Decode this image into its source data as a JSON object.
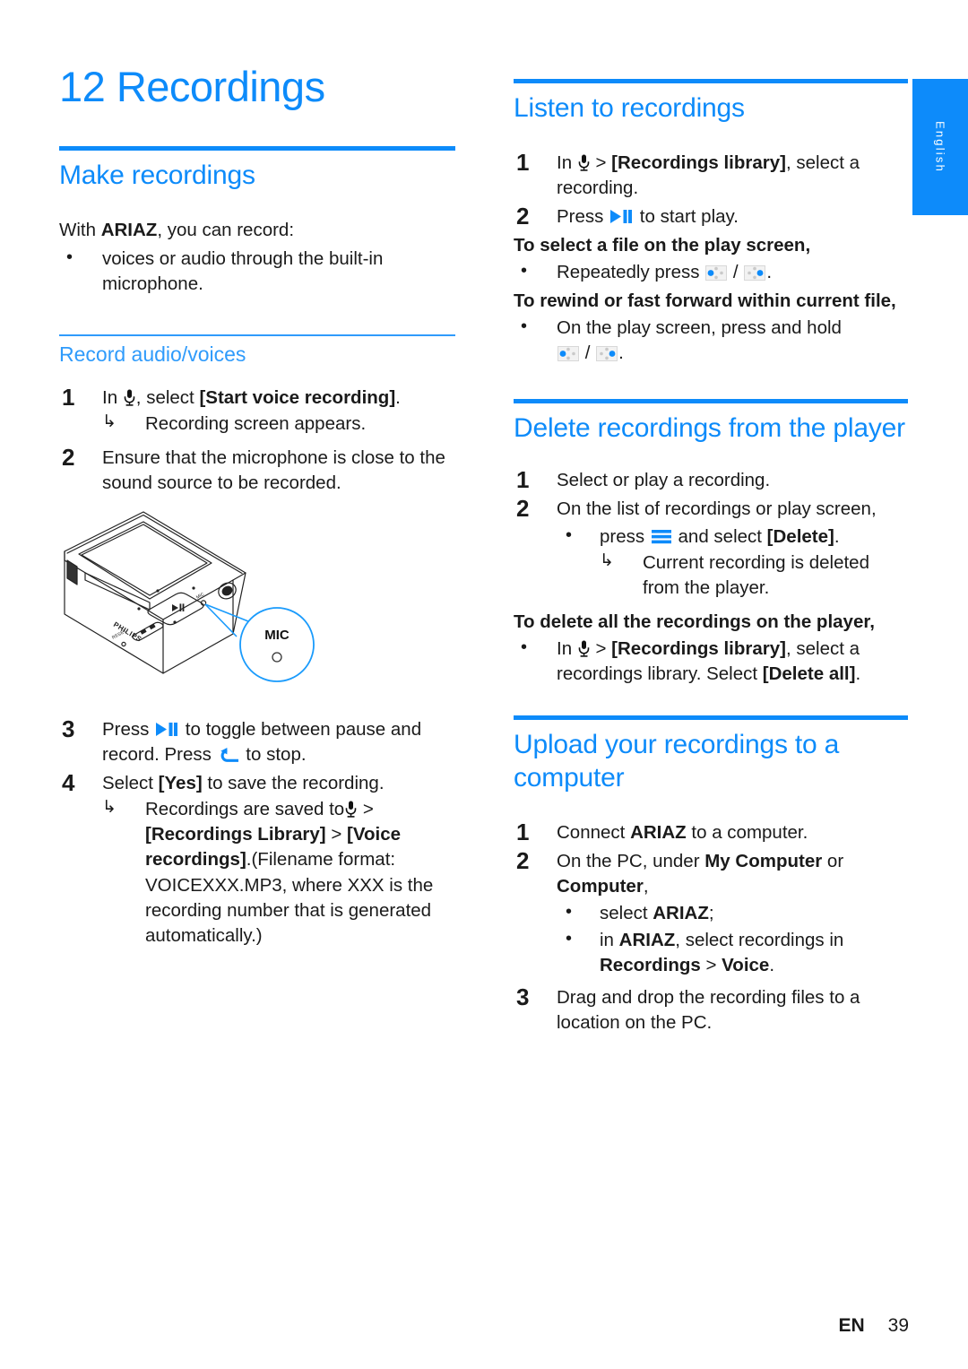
{
  "language_tab": {
    "label": "English"
  },
  "chapter": {
    "number": "12",
    "title": "Recordings",
    "heading": "12 Recordings"
  },
  "left_column": {
    "section_make": {
      "heading": "Make recordings",
      "intro_prefix": "With ",
      "intro_brand": "ARIAZ",
      "intro_suffix": ", you can record:",
      "bullet_1": "voices or audio through the built-in microphone."
    },
    "subsection_record": {
      "heading": "Record audio/voices",
      "step_1": {
        "num": "1",
        "text_before_icon": "In ",
        "icon": "mic-icon",
        "text_after_icon": ", select ",
        "bold_value": "[Start voice recording]",
        "text_end": ".",
        "result": "Recording screen appears."
      },
      "step_2": {
        "num": "2",
        "text": "Ensure that the microphone is close to the sound source to be recorded."
      },
      "illustration": {
        "brand_text": "PHILIPS",
        "reset_text": "RESET",
        "callout_label": "MIC"
      },
      "step_3": {
        "num": "3",
        "text_a": "Press ",
        "icon_a": "play-pause-icon",
        "text_b": " to toggle between pause and record. Press ",
        "icon_b": "back-icon",
        "text_c": " to stop."
      },
      "step_4": {
        "num": "4",
        "text_a": "Select ",
        "bold_a": "[Yes]",
        "text_b": " to save the recording.",
        "result_a": "Recordings are saved to",
        "result_icon": "mic-icon",
        "result_b": " > ",
        "result_bold_1": "[Recordings Library]",
        "result_c": " > ",
        "result_bold_2": "[Voice recordings]",
        "result_d": ".(Filename format: VOICEXXX.MP3, where XXX is the recording number that is generated automatically.)"
      }
    }
  },
  "right_column": {
    "section_listen": {
      "heading": "Listen to recordings",
      "step_1": {
        "num": "1",
        "text_a": "In ",
        "icon": "mic-icon",
        "text_b": " > ",
        "bold": "[Recordings library]",
        "text_c": ", select a recording."
      },
      "step_2": {
        "num": "2",
        "text_a": "Press ",
        "icon": "play-pause-icon",
        "text_b": " to start play."
      },
      "leadin_1": "To select a file on the play screen,",
      "bullet_1": {
        "text_a": "Repeatedly press ",
        "icon_prev": "nav-previous-icon",
        "text_b": " / ",
        "icon_next": "nav-next-icon",
        "text_c": "."
      },
      "leadin_2": "To rewind or fast forward within current file,",
      "bullet_2": {
        "text_a": "On the play screen, press and hold ",
        "icon_prev": "nav-previous-icon",
        "text_b": " / ",
        "icon_next": "nav-next-icon",
        "text_c": "."
      }
    },
    "section_delete": {
      "heading": "Delete recordings from the player",
      "step_1": {
        "num": "1",
        "text": "Select or play a recording."
      },
      "step_2": {
        "num": "2",
        "text": "On the list of recordings or play screen,",
        "bullet": {
          "text_a": "press ",
          "icon": "menu-icon",
          "text_b": " and select ",
          "bold": "[Delete]",
          "text_c": "."
        },
        "result": "Current recording is deleted from the player."
      },
      "leadin": "To delete all the recordings on the player,",
      "bullet": {
        "text_a": "In ",
        "icon": "mic-icon",
        "text_b": " > ",
        "bold_1": "[Recordings library]",
        "text_c": ", select a recordings library. Select ",
        "bold_2": "[Delete all]",
        "text_d": "."
      }
    },
    "section_upload": {
      "heading": "Upload your recordings to a computer",
      "step_1": {
        "num": "1",
        "text_a": "Connect ",
        "bold": "ARIAZ",
        "text_b": " to a computer."
      },
      "step_2": {
        "num": "2",
        "text_a": "On the PC, under ",
        "bold_1": "My Computer",
        "text_b": " or ",
        "bold_2": "Computer",
        "text_c": ",",
        "bullet_1": {
          "text_a": "select ",
          "bold": "ARIAZ",
          "text_b": ";"
        },
        "bullet_2": {
          "text_a": "in ",
          "bold_1": "ARIAZ",
          "text_b": ", select recordings in ",
          "bold_2": "Recordings",
          "text_c": " > ",
          "bold_3": "Voice",
          "text_d": "."
        }
      },
      "step_3": {
        "num": "3",
        "text": "Drag and drop the recording files to a location on the PC."
      }
    }
  },
  "footer": {
    "language_code": "EN",
    "page_number": "39"
  },
  "colors": {
    "accent_blue": "#0d8bfa",
    "light_blue": "#2f9bfb",
    "text_black": "#1a1a1a"
  }
}
